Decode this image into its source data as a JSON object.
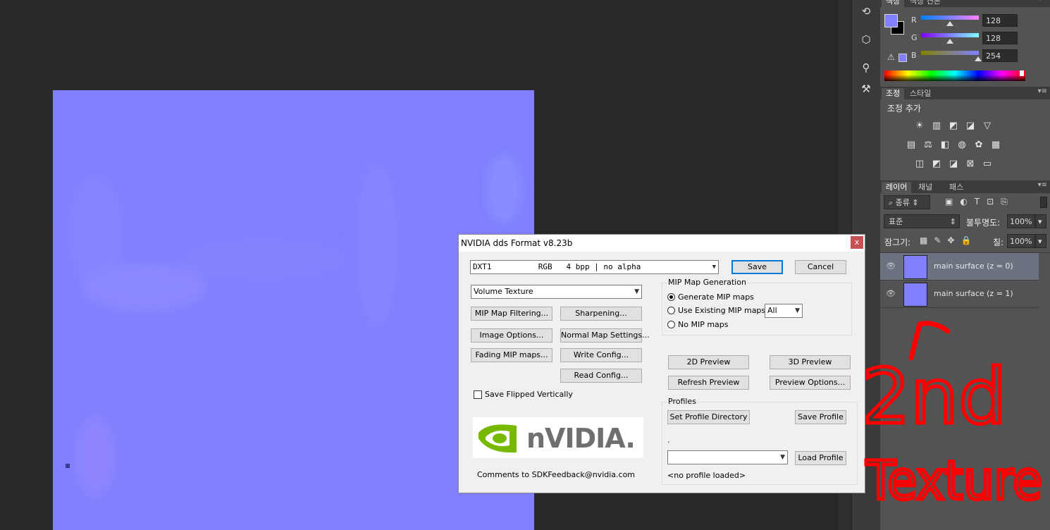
{
  "colors": {
    "workspace": "#282828",
    "canvas": "#807ffd",
    "panel": "#535353",
    "dialog": "#f0f0f0",
    "annotation": "#ff0000",
    "foreground_swatch": "#8080fe",
    "background_swatch": "#000000"
  },
  "color_panel": {
    "tabs": [
      "색상",
      "색상 견본"
    ],
    "r_label": "R",
    "r_value": "128",
    "g_label": "G",
    "g_value": "128",
    "b_label": "B",
    "b_value": "254"
  },
  "adjust_panel": {
    "tabs": [
      "조정",
      "스타일"
    ],
    "heading": "조정 추가"
  },
  "layers_panel": {
    "tabs": [
      "레이어",
      "채널",
      "패스"
    ],
    "filter_label": "종류",
    "blend_mode": "표준",
    "opacity_label": "불투명도:",
    "opacity_value": "100%",
    "lock_label": "잠그기:",
    "fill_label": "칠:",
    "fill_value": "100%",
    "layers": [
      {
        "name": "main surface (z = 0)",
        "selected": true
      },
      {
        "name": "main surface (z = 1)",
        "selected": false
      }
    ]
  },
  "dialog": {
    "title": "NVIDIA dds Format v8.23b",
    "close_glyph": "x",
    "format_value": "DXT1          RGB   4 bpp | no alpha",
    "save": "Save",
    "cancel": "Cancel",
    "texture_type": "Volume Texture",
    "mip_filtering": "MIP Map Filtering...",
    "sharpening": "Sharpening...",
    "image_options": "Image Options...",
    "normal_map_settings": "Normal Map Settings...",
    "fading_mip": "Fading MIP maps...",
    "write_config": "Write Config...",
    "read_config": "Read Config...",
    "save_flipped": "Save Flipped Vertically",
    "mip_group": "MIP Map Generation",
    "mip_generate": "Generate MIP maps",
    "mip_existing": "Use Existing MIP maps",
    "mip_none": "No MIP maps",
    "mip_count": "All",
    "preview_2d": "2D Preview",
    "preview_3d": "3D Preview",
    "refresh_preview": "Refresh Preview",
    "preview_options": "Preview Options...",
    "profiles_group": "Profiles",
    "set_profile_dir": "Set Profile Directory",
    "save_profile": "Save Profile",
    "profile_dot": ".",
    "load_profile": "Load Profile",
    "no_profile": "<no profile loaded>",
    "logo_text": "nVIDIA.",
    "comments": "Comments to SDKFeedback@nvidia.com"
  },
  "annotation": {
    "text_line1": "2nd",
    "text_line2": "Texture"
  }
}
